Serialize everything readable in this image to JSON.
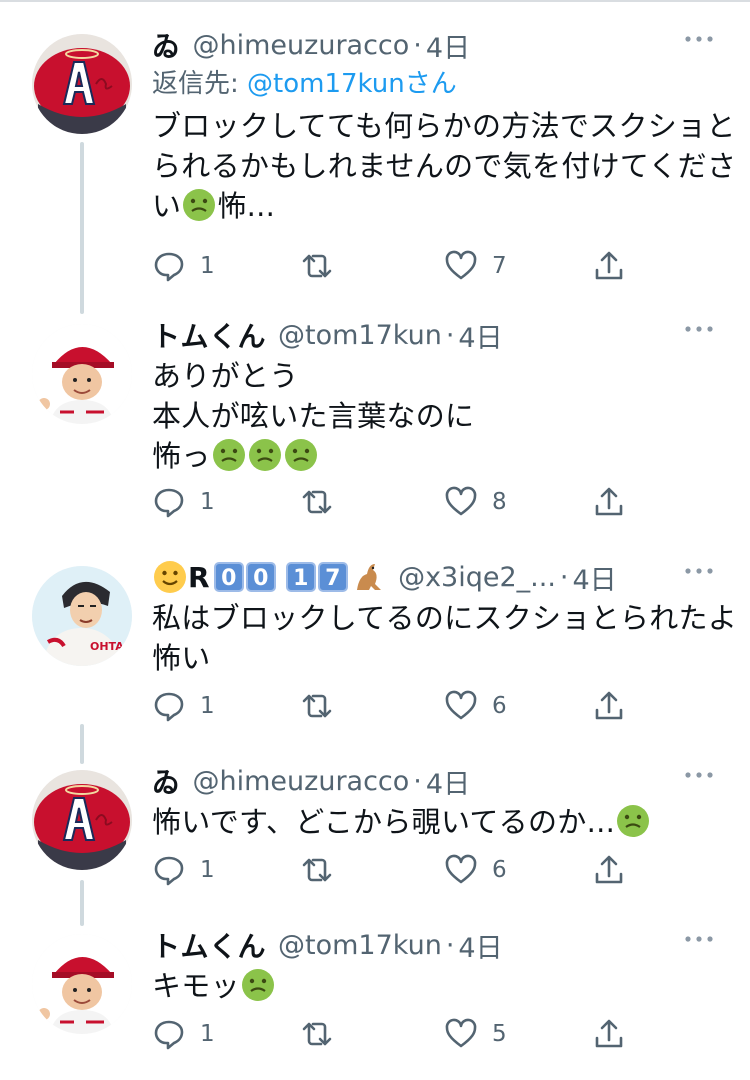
{
  "tweets": [
    {
      "name": "ゐ",
      "handle": "@himeuzuracco",
      "separator": "·",
      "time": "4日",
      "reply_prefix": "返信先: ",
      "reply_to": "@tom17kunさん",
      "lines": [
        "ブロックしてても何らかの方法でスクショと",
        "られるかもしれませんので気を付けてくださ",
        "い",
        "怖..."
      ],
      "counts": {
        "reply": "1",
        "retweet": "",
        "like": "7"
      },
      "avatar": "angels-cap-icon"
    },
    {
      "name": "トムくん",
      "handle": "@tom17kun",
      "separator": "·",
      "time": "4日",
      "lines": [
        "ありがとう",
        "本人が呟いた言葉なのに",
        "怖っ"
      ],
      "counts": {
        "reply": "1",
        "retweet": "",
        "like": "8"
      },
      "avatar": "angels-player-icon"
    },
    {
      "name_prefix": "R",
      "name_keycaps": [
        "0",
        "0",
        "1",
        "7"
      ],
      "handle": "@x3iqe2_...",
      "separator": "·",
      "time": "4日",
      "lines": [
        "私はブロックしてるのにスクショとられたよ",
        "怖い"
      ],
      "counts": {
        "reply": "1",
        "retweet": "",
        "like": "6"
      },
      "avatar": "ohtani-illustration-icon"
    },
    {
      "name": "ゐ",
      "handle": "@himeuzuracco",
      "separator": "·",
      "time": "4日",
      "lines": [
        "怖いです、どこから覗いてるのか..."
      ],
      "counts": {
        "reply": "1",
        "retweet": "",
        "like": "6"
      },
      "avatar": "angels-cap-icon"
    },
    {
      "name": "トムくん",
      "handle": "@tom17kun",
      "separator": "·",
      "time": "4日",
      "lines": [
        "キモッ"
      ],
      "counts": {
        "reply": "1",
        "retweet": "",
        "like": "5"
      },
      "avatar": "angels-player-icon"
    }
  ],
  "colors": {
    "link": "#1d9bf0",
    "secondary_text": "#536471",
    "thread_line": "#cfd9de",
    "nauseated_emoji": "#8bc34a"
  },
  "icons": [
    "reply-icon",
    "retweet-icon",
    "like-icon",
    "share-icon",
    "more-icon",
    "nauseated-face-emoji",
    "slightly-smiling-face-emoji",
    "kangaroo-emoji"
  ]
}
